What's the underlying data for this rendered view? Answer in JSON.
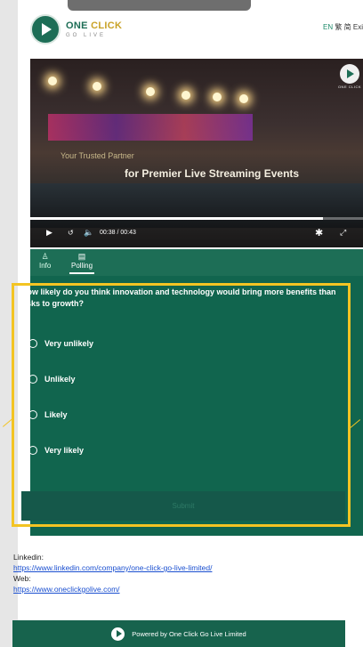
{
  "header": {
    "logo_title_1": "ONE ",
    "logo_title_2": "CLICK",
    "logo_sub": "GO LIVE",
    "lang_en": "EN",
    "lang_zh_trad": "繁",
    "lang_zh_simp": "简",
    "exit_label": "Exi"
  },
  "video": {
    "subtitle": "Your Trusted Partner",
    "headline": "for Premier Live Streaming Events",
    "time": "00:38 / 00:43",
    "progress": 0.88,
    "badge_text": "ONE CLICK"
  },
  "tabs": [
    {
      "label": "Info",
      "icon": "info-icon"
    },
    {
      "label": "Polling",
      "icon": "poll-icon"
    }
  ],
  "poll": {
    "question": "How likely do you think innovation and technology would bring more benefits than risks to growth?",
    "options": [
      "Very unlikely",
      "Unlikely",
      "Likely",
      "Very likely"
    ],
    "submit_label": "Submit"
  },
  "info": {
    "linkedin_label": "Linkedin:",
    "linkedin_url": "https://www.linkedin.com/company/one-click-go-live-limited/",
    "web_label": "Web:",
    "web_url": "https://www.oneclickgolive.com/"
  },
  "footer": {
    "text": "Powered by One Click Go Live Limited"
  },
  "colors": {
    "brand_green": "#11654e",
    "highlight": "#f3c423"
  }
}
